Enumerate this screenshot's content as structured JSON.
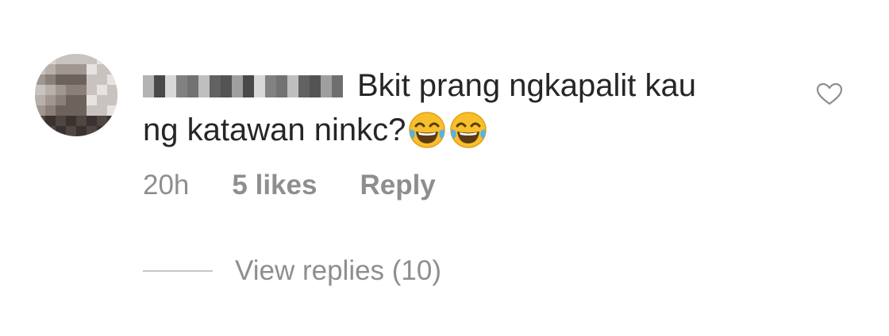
{
  "comment": {
    "text_line1": "Bkit prang ngkapalit kau",
    "text_line2": "ng katawan ninkc?",
    "emojis": [
      "face-with-tears-of-joy-icon",
      "face-with-tears-of-joy-icon"
    ],
    "time": "20h",
    "likes": "5 likes",
    "reply_label": "Reply",
    "like_icon": "heart-outline-icon"
  },
  "replies": {
    "label": "View replies (10)"
  },
  "colors": {
    "text": "#262626",
    "secondary": "#8e8e8e",
    "divider": "#c7c7c7",
    "background": "#ffffff"
  }
}
